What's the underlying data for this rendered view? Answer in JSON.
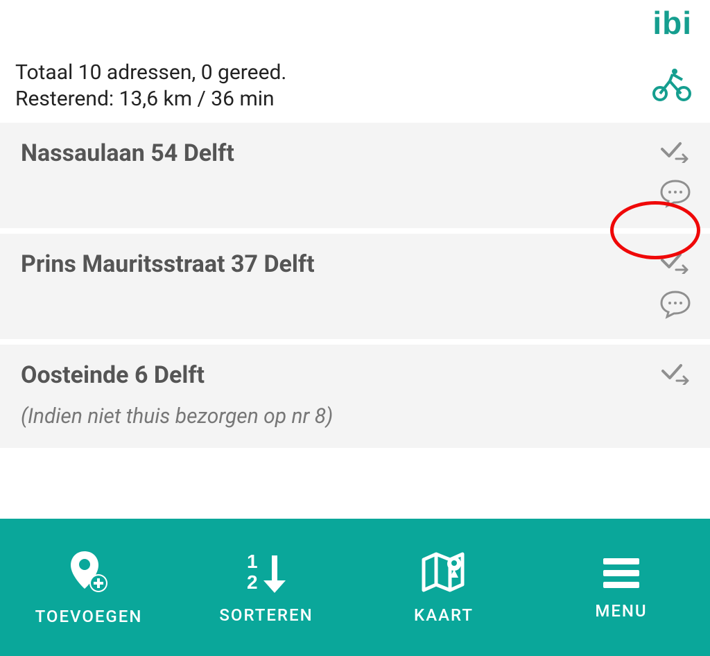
{
  "brand": {
    "logo_text": "ibi"
  },
  "summary": {
    "line1": "Totaal 10 adressen, 0 gereed.",
    "line2": "Resterend: 13,6 km / 36 min"
  },
  "addresses": [
    {
      "title": "Nassaulaan 54 Delft",
      "note": ""
    },
    {
      "title": "Prins Mauritsstraat 37 Delft",
      "note": ""
    },
    {
      "title": "Oosteinde 6 Delft",
      "note": "(Indien niet thuis bezorgen op nr 8)"
    }
  ],
  "bottom_bar": {
    "add": {
      "label": "TOEVOEGEN"
    },
    "sort": {
      "label": "SORTEREN"
    },
    "map": {
      "label": "KAART"
    },
    "menu": {
      "label": "MENU"
    }
  },
  "colors": {
    "accent": "#0aa79a",
    "brand": "#159e8f",
    "annotation": "#ef0808"
  }
}
